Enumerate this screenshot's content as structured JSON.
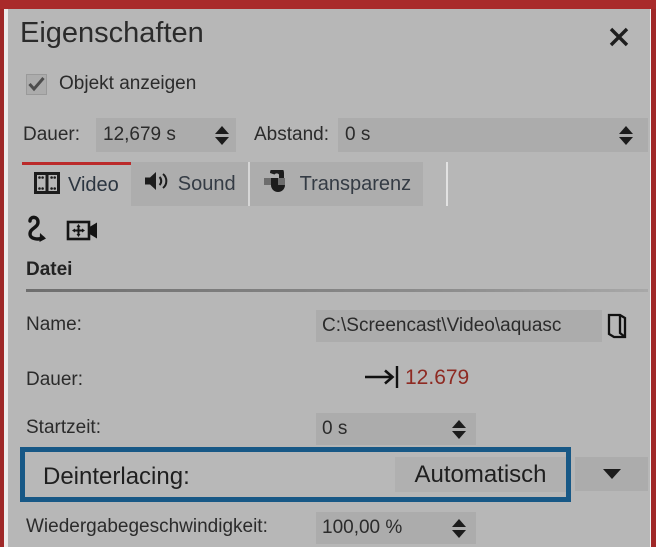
{
  "window": {
    "title": "Eigenschaften",
    "close_icon": "close-icon",
    "accent_red": "#a92a2a",
    "background": "#b7b7b7"
  },
  "visibility": {
    "checkbox_label": "Objekt anzeigen",
    "checked": true,
    "check_icon": "checkmark-icon"
  },
  "timing": {
    "duration_label": "Dauer:",
    "duration_value": "12,679 s",
    "gap_label": "Abstand:",
    "gap_value": "0 s",
    "spinner_icon": "spinner-updown-icon"
  },
  "tabs": [
    {
      "label": "Video",
      "icon": "film-frame-icon",
      "active": true
    },
    {
      "label": "Sound",
      "icon": "speaker-icon",
      "active": false
    },
    {
      "label": "Transparenz",
      "icon": "transparency-icon",
      "active": false
    }
  ],
  "toolbar_icons": [
    {
      "name": "rotate-arrow-icon"
    },
    {
      "name": "camera-pan-icon"
    }
  ],
  "section": {
    "title": "Datei"
  },
  "fields": {
    "name_label": "Name:",
    "name_value": "C:\\Screencast\\Video\\aquasc",
    "browse_icon": "folder-open-icon",
    "duration_label": "Dauer:",
    "duration_marker_icon": "arrow-to-end-icon",
    "duration_value": "12.679",
    "duration_value_color": "#8e2a22",
    "starttime_label": "Startzeit:",
    "starttime_value": "0 s",
    "playback_label": "Wiedergabegeschwindigkeit:",
    "playback_value": "100,00 %"
  },
  "highlight": {
    "label": "Deinterlacing:",
    "selected_option": "Automatisch",
    "border_color": "#175886",
    "dropdown_icon": "chevron-down-icon"
  }
}
